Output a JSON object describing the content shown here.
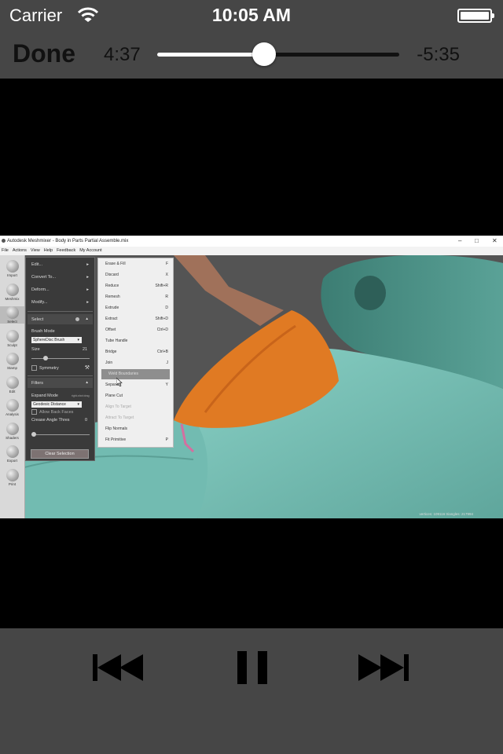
{
  "status_bar": {
    "carrier": "Carrier",
    "time": "10:05 AM",
    "wifi_icon": "wifi-icon",
    "battery_icon": "battery-icon"
  },
  "player_top": {
    "done_label": "Done",
    "elapsed": "4:37",
    "remaining": "-5:35",
    "progress_fraction": 0.44
  },
  "video": {
    "window_title": "Autodesk Meshmixer - Body in Parts Partial Assemble.mix",
    "menu": [
      "File",
      "Actions",
      "View",
      "Help",
      "Feedback",
      "My Account"
    ],
    "tools": [
      "Import",
      "Meshmix",
      "Select",
      "Sculpt",
      "Stamp",
      "Edit",
      "Analysis",
      "Shaders",
      "Export",
      "Print"
    ],
    "panel_items": [
      "Edit...",
      "Convert To...",
      "Deform...",
      "Modify..."
    ],
    "select_section": "Select",
    "brush_mode_label": "Brush Mode",
    "brush_mode_value": "SphereDisc Brush",
    "size_label": "Size",
    "size_value": "21",
    "symmetry_label": "Symmetry",
    "filters_section": "Filters",
    "expand_mode_label": "Expand Mode",
    "expand_mode_hint": "right-shot drag",
    "expand_mode_value": "Geodesic Distance",
    "allow_back_faces_label": "Allow Back Faces",
    "crease_angle_label": "Crease Angle Thres",
    "crease_angle_value": "0",
    "clear_selection_label": "Clear Selection",
    "context_menu": [
      {
        "label": "Erase & Fill",
        "key": "F",
        "state": "normal"
      },
      {
        "label": "Discard",
        "key": "X",
        "state": "normal"
      },
      {
        "label": "Reduce",
        "key": "Shift+R",
        "state": "normal"
      },
      {
        "label": "Remesh",
        "key": "R",
        "state": "normal"
      },
      {
        "label": "Extrude",
        "key": "D",
        "state": "normal"
      },
      {
        "label": "Extract",
        "key": "Shift+D",
        "state": "normal"
      },
      {
        "label": "Offset",
        "key": "Ctrl+D",
        "state": "normal"
      },
      {
        "label": "Tube Handle",
        "key": "",
        "state": "normal"
      },
      {
        "label": "Bridge",
        "key": "Ctrl+B",
        "state": "normal"
      },
      {
        "label": "Join",
        "key": "J",
        "state": "normal"
      },
      {
        "label": "Weld Boundaries",
        "key": "",
        "state": "highlighted"
      },
      {
        "label": "Separate",
        "key": "Y",
        "state": "normal"
      },
      {
        "label": "Plane Cut",
        "key": "",
        "state": "normal"
      },
      {
        "label": "Align To Target",
        "key": "",
        "state": "disabled"
      },
      {
        "label": "Attract To Target",
        "key": "",
        "state": "disabled"
      },
      {
        "label": "Flip Normals",
        "key": "",
        "state": "normal"
      },
      {
        "label": "Fit Primitive",
        "key": "P",
        "state": "normal"
      }
    ],
    "stats": "vertices: 109116 triangles: 217994"
  },
  "player_bottom": {
    "prev_icon": "skip-back-icon",
    "pause_icon": "pause-icon",
    "next_icon": "skip-forward-icon"
  },
  "colors": {
    "bar_bg": "#464646",
    "mesh_teal": "#7fc4bb",
    "selection_orange": "#e07a23"
  }
}
